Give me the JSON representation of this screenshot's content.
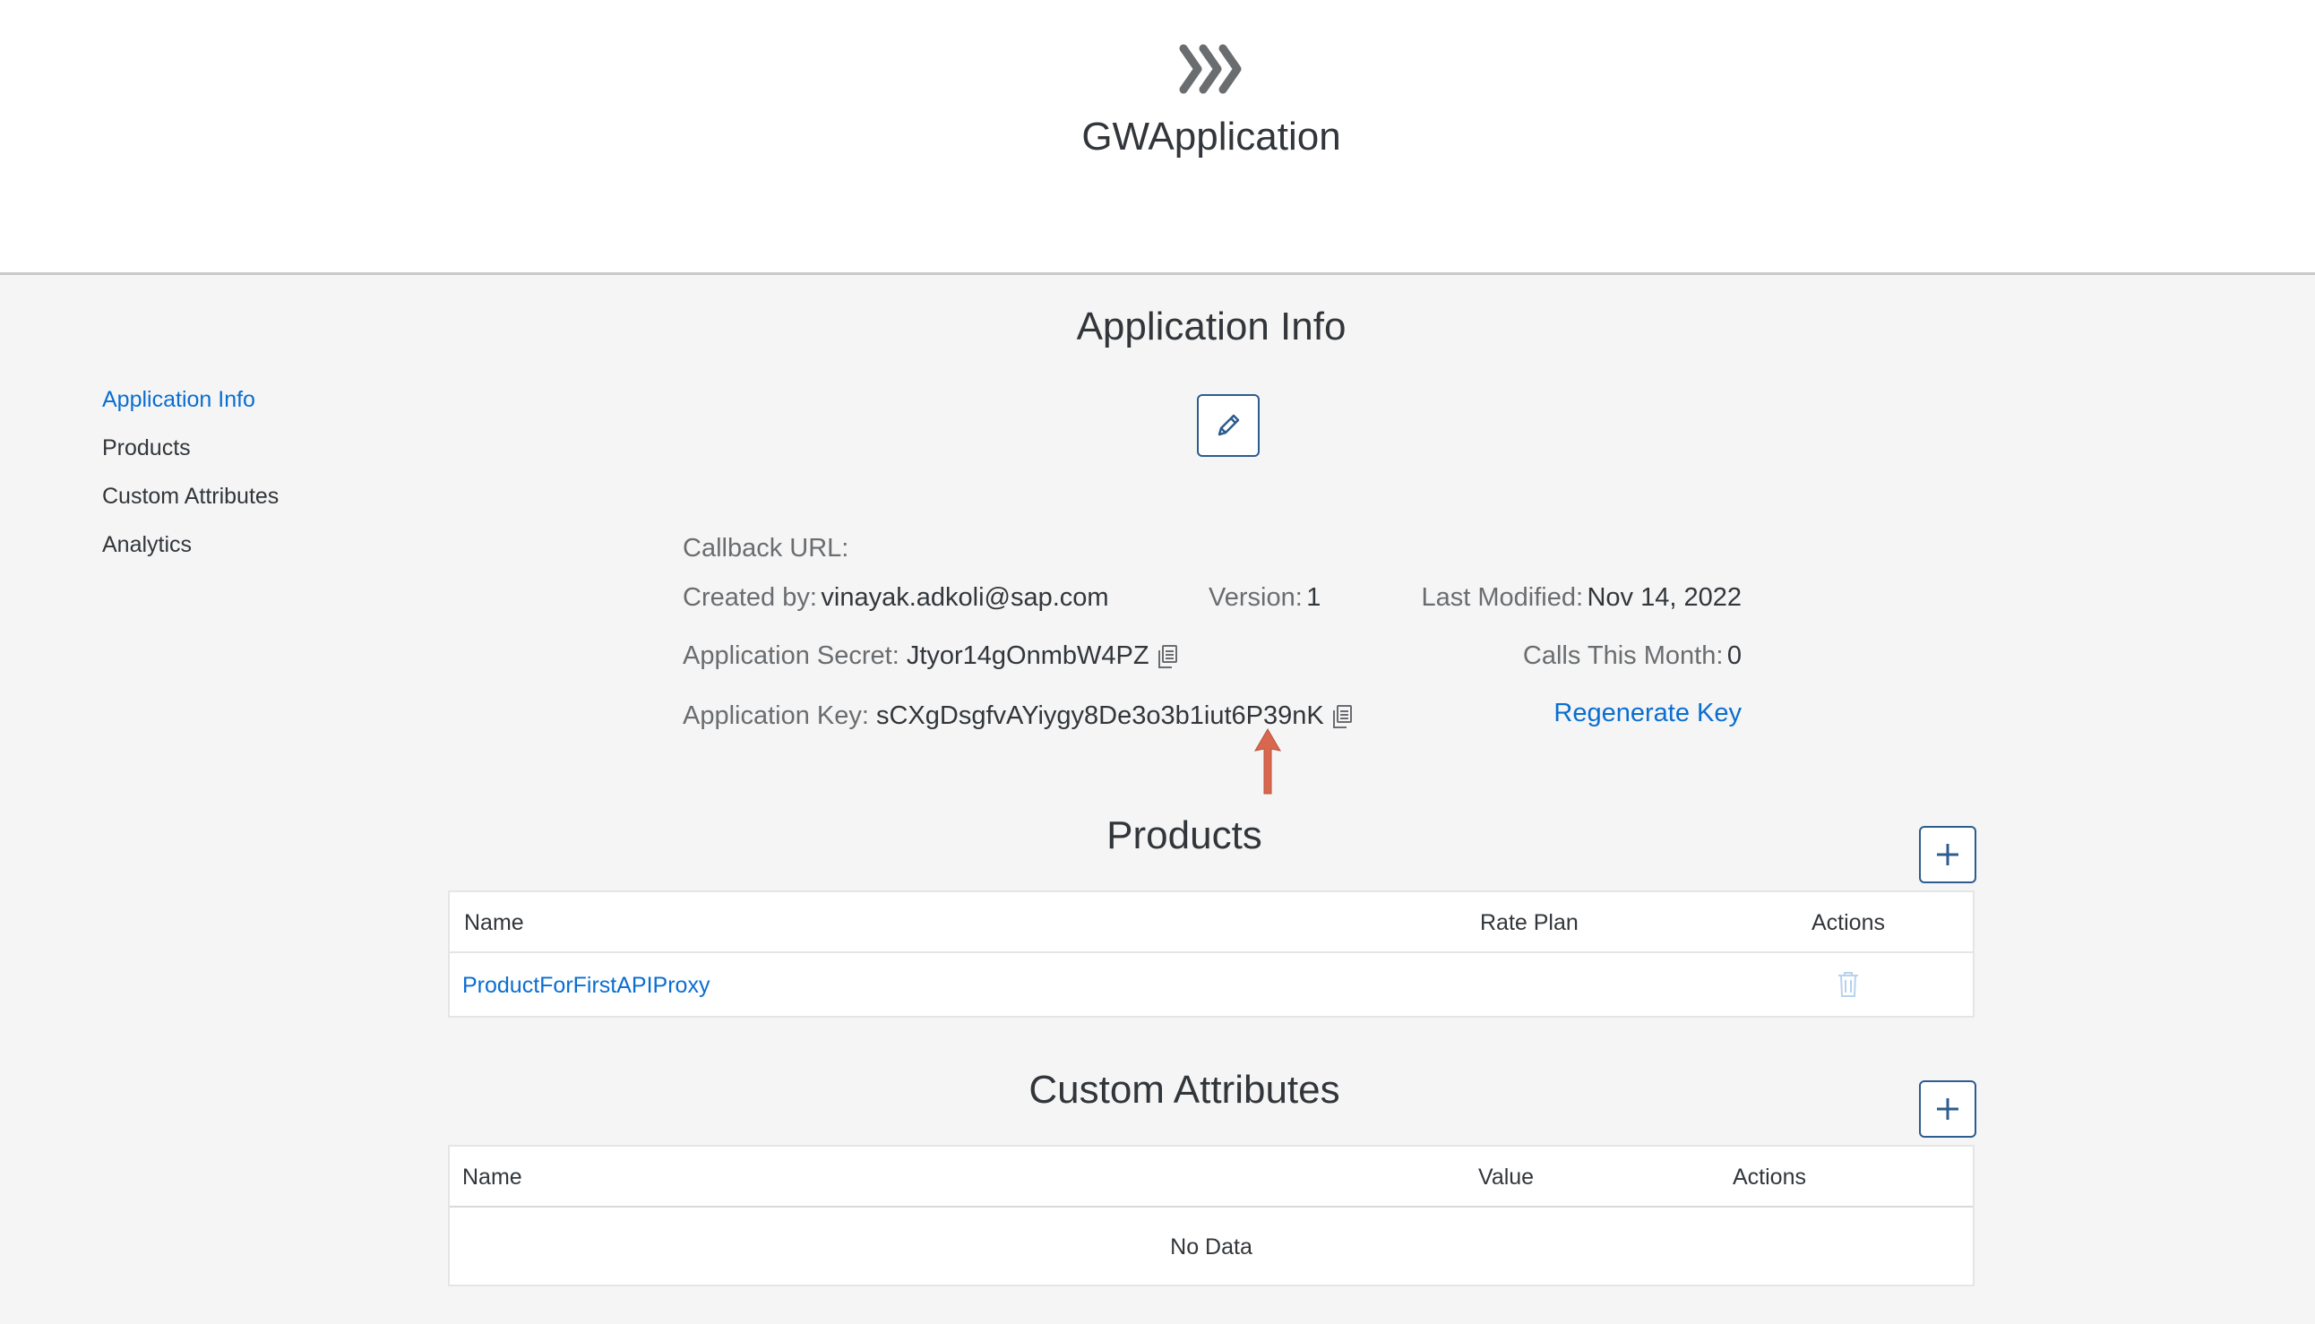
{
  "header": {
    "logo_icon": "triple-chevron-icon",
    "app_title": "GWApplication"
  },
  "sidebar": {
    "items": [
      {
        "label": "Application Info",
        "active": true
      },
      {
        "label": "Products",
        "active": false
      },
      {
        "label": "Custom Attributes",
        "active": false
      },
      {
        "label": "Analytics",
        "active": false
      }
    ]
  },
  "app_info": {
    "title": "Application Info",
    "edit_icon": "pencil-icon",
    "callback_url_label": "Callback URL:",
    "created_by_label": "Created by:",
    "created_by_value": "vinayak.adkoli@sap.com",
    "version_label": "Version:",
    "version_value": "1",
    "last_modified_label": "Last Modified:",
    "last_modified_value": "Nov 14, 2022",
    "secret_label": "Application Secret:",
    "secret_value": "Jtyor14gOnmbW4PZ",
    "calls_label": "Calls This Month:",
    "calls_value": "0",
    "key_label": "Application Key:",
    "key_value": "sCXgDsgfvAYiygy8De3o3b1iut6P39nK",
    "regenerate_label": "Regenerate Key",
    "copy_icon": "copy-icon",
    "annotation_icon": "red-arrow-up-icon"
  },
  "products": {
    "title": "Products",
    "add_icon": "plus-icon",
    "columns": [
      "Name",
      "Rate Plan",
      "Actions"
    ],
    "rows": [
      {
        "name": "ProductForFirstAPIProxy",
        "rate_plan": "",
        "action_icon": "trash-icon"
      }
    ]
  },
  "custom_attributes": {
    "title": "Custom Attributes",
    "add_icon": "plus-icon",
    "columns": [
      "Name",
      "Value",
      "Actions"
    ],
    "empty_text": "No Data"
  },
  "colors": {
    "accent": "#0a6ed1",
    "button_border": "#2d5c8e",
    "annotation": "#d9674e"
  }
}
